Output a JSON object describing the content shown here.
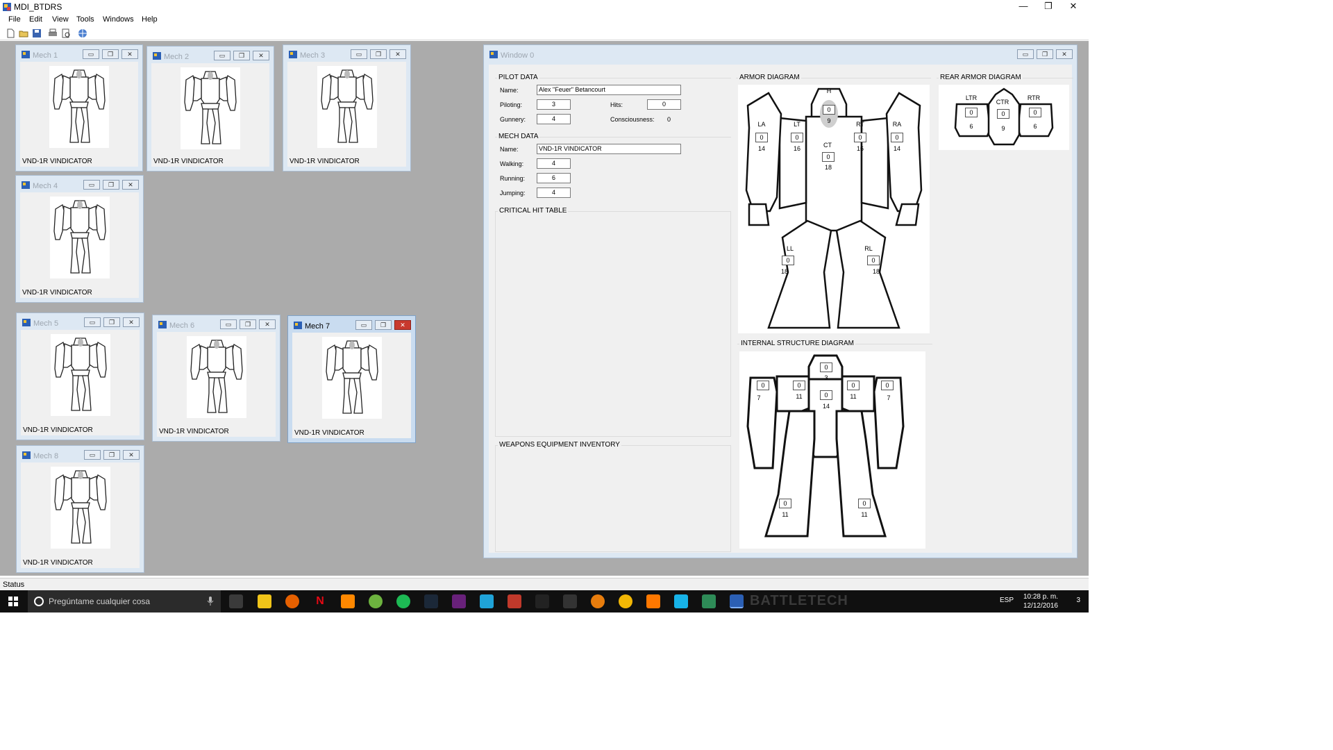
{
  "app": {
    "title": "MDI_BTDRS",
    "minimize": "—",
    "restore": "❐",
    "close": "✕"
  },
  "menu": [
    "File",
    "Edit",
    "View",
    "Tools",
    "Windows",
    "Help"
  ],
  "toolbar": [
    "new-icon",
    "open-icon",
    "save-icon",
    "print-icon",
    "print-preview-icon",
    "web-icon"
  ],
  "child_windows": [
    {
      "title": "Mech 1",
      "label": "VND-1R VINDICATOR"
    },
    {
      "title": "Mech 2",
      "label": "VND-1R VINDICATOR"
    },
    {
      "title": "Mech 3",
      "label": "VND-1R VINDICATOR"
    },
    {
      "title": "Mech 4",
      "label": "VND-1R VINDICATOR"
    },
    {
      "title": "Mech 5",
      "label": "VND-1R VINDICATOR"
    },
    {
      "title": "Mech 6",
      "label": "VND-1R VINDICATOR"
    },
    {
      "title": "Mech 7",
      "label": "VND-1R VINDICATOR"
    },
    {
      "title": "Mech 8",
      "label": "VND-1R VINDICATOR"
    }
  ],
  "window0": {
    "title": "Window 0",
    "pilot": {
      "heading": "PILOT DATA",
      "name_label": "Name:",
      "name": "Alex \"Feuer\" Betancourt",
      "piloting_label": "Piloting:",
      "piloting": "3",
      "gunnery_label": "Gunnery:",
      "gunnery": "4",
      "hits_label": "Hits:",
      "hits": "0",
      "consciousness_label": "Consciousness:",
      "consciousness": "0"
    },
    "mech": {
      "heading": "MECH DATA",
      "name_label": "Name:",
      "name": "VND-1R VINDICATOR",
      "walking_label": "Walking:",
      "walking": "4",
      "running_label": "Running:",
      "running": "6",
      "jumping_label": "Jumping:",
      "jumping": "4"
    },
    "critical_heading": "CRITICAL HIT TABLE",
    "weapons_heading": "WEAPONS  EQUIPMENT INVENTORY",
    "armor": {
      "heading": "ARMOR DIAGRAM",
      "H": {
        "label": "H",
        "value": "0",
        "max": "9"
      },
      "LA": {
        "label": "LA",
        "value": "0",
        "max": "14"
      },
      "LT": {
        "label": "LT",
        "value": "0",
        "max": "16"
      },
      "CT": {
        "label": "CT",
        "value": "0",
        "max": "18"
      },
      "RT": {
        "label": "RT",
        "value": "0",
        "max": "16"
      },
      "RA": {
        "label": "RA",
        "value": "0",
        "max": "14"
      },
      "LL": {
        "label": "LL",
        "value": "0",
        "max": "18"
      },
      "RL": {
        "label": "RL",
        "value": "0",
        "max": "18"
      }
    },
    "rear": {
      "heading": "REAR ARMOR DIAGRAM",
      "LTR": {
        "label": "LTR",
        "value": "0",
        "max": "6"
      },
      "CTR": {
        "label": "CTR",
        "value": "0",
        "max": "9"
      },
      "RTR": {
        "label": "RTR",
        "value": "0",
        "max": "6"
      }
    },
    "internal": {
      "heading": "INTERNAL STRUCTURE DIAGRAM",
      "H": {
        "value": "0",
        "max": "3"
      },
      "LA": {
        "value": "0",
        "max": "7"
      },
      "LT": {
        "value": "0",
        "max": "11"
      },
      "CT": {
        "value": "0",
        "max": "14"
      },
      "RT": {
        "value": "0",
        "max": "11"
      },
      "RA": {
        "value": "0",
        "max": "7"
      },
      "LL": {
        "value": "0",
        "max": "11"
      },
      "RL": {
        "value": "0",
        "max": "11"
      }
    }
  },
  "status": "Status",
  "taskbar": {
    "search_placeholder": "Pregúntame cualquier cosa",
    "apps": [
      "task-view-icon",
      "file-explorer-icon",
      "firefox-icon",
      "netflix-icon",
      "vlc-icon",
      "utorrent-icon",
      "spotify-icon",
      "steam-icon",
      "visual-studio-icon",
      "ccleaner-icon",
      "roblox-icon",
      "unity-icon",
      "epic-games-icon",
      "blender-icon",
      "fl-studio-icon",
      "avast-icon",
      "kodi-icon",
      "app-icon",
      "mdi-btdrs-icon"
    ],
    "watermark": "BATTLETECH",
    "language": "ESP",
    "time": "10:28 p. m.",
    "date": "12/12/2016",
    "notifications": "3"
  }
}
